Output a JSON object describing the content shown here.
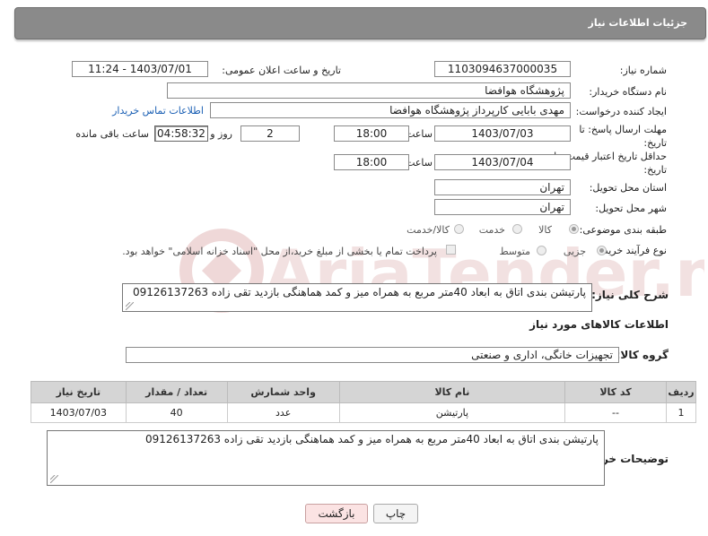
{
  "header": {
    "title": "جزئیات اطلاعات نیاز"
  },
  "fields": {
    "need_number_label": "شماره نیاز:",
    "need_number": "1103094637000035",
    "announce_label": "تاریخ و ساعت اعلان عمومی:",
    "announce_value": "1403/07/01 - 11:24",
    "buyer_org_label": "نام دستگاه خریدار:",
    "buyer_org": "پژوهشگاه هوافضا",
    "creator_label": "ایجاد کننده درخواست:",
    "creator": "مهدی بابایی کارپرداز پژوهشگاه هوافضا",
    "contact_link": "اطلاعات تماس خریدار",
    "deadline_label": "مهلت ارسال پاسخ: تا تاریخ:",
    "deadline_date": "1403/07/03",
    "time_label": "ساعت",
    "deadline_time": "18:00",
    "days_value": "2",
    "days_label": "روز و",
    "remaining_time": "04:58:32",
    "remaining_label": "ساعت باقی مانده",
    "validity_label": "حداقل تاریخ اعتبار قیمت: تا تاریخ:",
    "validity_date": "1403/07/04",
    "validity_time": "18:00",
    "province_label": "استان محل تحویل:",
    "province": "تهران",
    "city_label": "شهر محل تحویل:",
    "city": "تهران",
    "category_label": "طبقه بندی موضوعی:",
    "category_options": [
      "کالا",
      "خدمت",
      "کالا/خدمت"
    ],
    "process_label": "نوع فرآیند خرید :",
    "process_options": [
      "جزیی",
      "متوسط"
    ],
    "payment_note": "پرداخت تمام یا بخشی از مبلغ خرید،از محل \"اسناد خزانه اسلامی\" خواهد بود."
  },
  "description": {
    "label": "شرح کلی نیاز:",
    "text": "پارتیشن بندی اتاق به ابعاد 40متر مربع به همراه میز  و کمد      هماهنگی بازدید تقی زاده 09126137263"
  },
  "goods": {
    "section_title": "اطلاعات کالاهای مورد نیاز",
    "group_label": "گروه کالا:",
    "group_value": "تجهیزات خانگی، اداری و صنعتی",
    "table": {
      "headers": [
        "ردیف",
        "کد کالا",
        "نام کالا",
        "واحد شمارش",
        "تعداد / مقدار",
        "تاریخ نیاز"
      ],
      "rows": [
        [
          "1",
          "--",
          "پارتیشن",
          "عدد",
          "40",
          "1403/07/03"
        ]
      ]
    }
  },
  "buyer_notes": {
    "label": "توضیحات خریدار:",
    "text": "پارتیشن بندی اتاق به ابعاد 40متر مربع به همراه میز  و کمد      هماهنگی بازدید تقی زاده 09126137263"
  },
  "buttons": {
    "print": "چاپ",
    "back": "بازگشت"
  },
  "watermark": {
    "text": "AriaTender.neT",
    "color": "#e8c9c9"
  }
}
